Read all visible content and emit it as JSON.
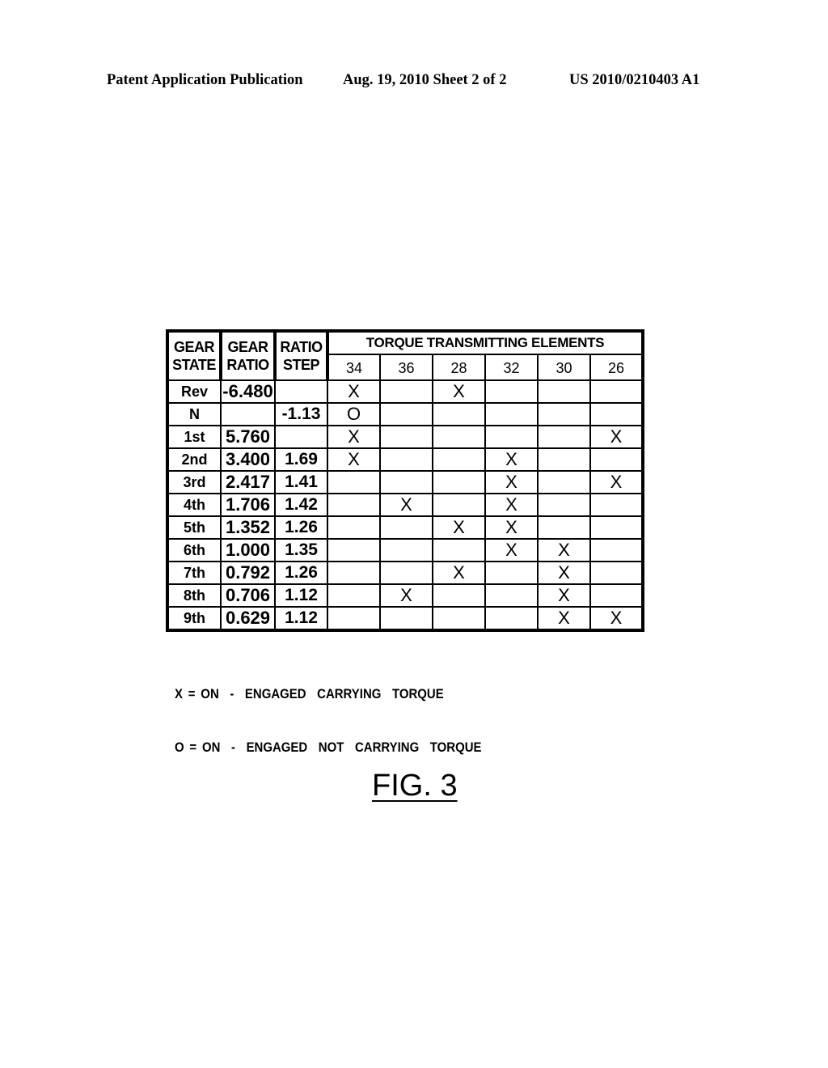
{
  "header": {
    "publication": "Patent Application Publication",
    "date_sheet": "Aug. 19, 2010  Sheet 2 of 2",
    "patent_number": "US 2010/0210403 A1"
  },
  "table": {
    "columns": {
      "gear_state": [
        "GEAR",
        "STATE"
      ],
      "gear_ratio": [
        "GEAR",
        "RATIO"
      ],
      "ratio_step": [
        "RATIO",
        "STEP"
      ]
    },
    "elements_title": "TORQUE TRANSMITTING ELEMENTS",
    "elements": [
      "34",
      "36",
      "28",
      "32",
      "30",
      "26"
    ],
    "rows": [
      {
        "state": "Rev",
        "ratio": "-6.480",
        "step": "",
        "marks": [
          "X",
          "",
          "X",
          "",
          "",
          ""
        ]
      },
      {
        "state": "N",
        "ratio": "",
        "step": "-1.13",
        "marks": [
          "O",
          "",
          "",
          "",
          "",
          ""
        ]
      },
      {
        "state": "1st",
        "ratio": "5.760",
        "step": "",
        "marks": [
          "X",
          "",
          "",
          "",
          "",
          "X"
        ]
      },
      {
        "state": "2nd",
        "ratio": "3.400",
        "step": "1.69",
        "marks": [
          "X",
          "",
          "",
          "X",
          "",
          ""
        ]
      },
      {
        "state": "3rd",
        "ratio": "2.417",
        "step": "1.41",
        "marks": [
          "",
          "",
          "",
          "X",
          "",
          "X"
        ]
      },
      {
        "state": "4th",
        "ratio": "1.706",
        "step": "1.42",
        "marks": [
          "",
          "X",
          "",
          "X",
          "",
          ""
        ]
      },
      {
        "state": "5th",
        "ratio": "1.352",
        "step": "1.26",
        "marks": [
          "",
          "",
          "X",
          "X",
          "",
          ""
        ]
      },
      {
        "state": "6th",
        "ratio": "1.000",
        "step": "1.35",
        "marks": [
          "",
          "",
          "",
          "X",
          "X",
          ""
        ]
      },
      {
        "state": "7th",
        "ratio": "0.792",
        "step": "1.26",
        "marks": [
          "",
          "",
          "X",
          "",
          "X",
          ""
        ]
      },
      {
        "state": "8th",
        "ratio": "0.706",
        "step": "1.12",
        "marks": [
          "",
          "X",
          "",
          "",
          "X",
          ""
        ]
      },
      {
        "state": "9th",
        "ratio": "0.629",
        "step": "1.12",
        "marks": [
          "",
          "",
          "",
          "",
          "X",
          "X"
        ]
      }
    ]
  },
  "legend": [
    "X = ON  -  ENGAGED  CARRYING  TORQUE",
    "O = ON  -  ENGAGED  NOT  CARRYING  TORQUE"
  ],
  "figure_label": "FIG. 3"
}
